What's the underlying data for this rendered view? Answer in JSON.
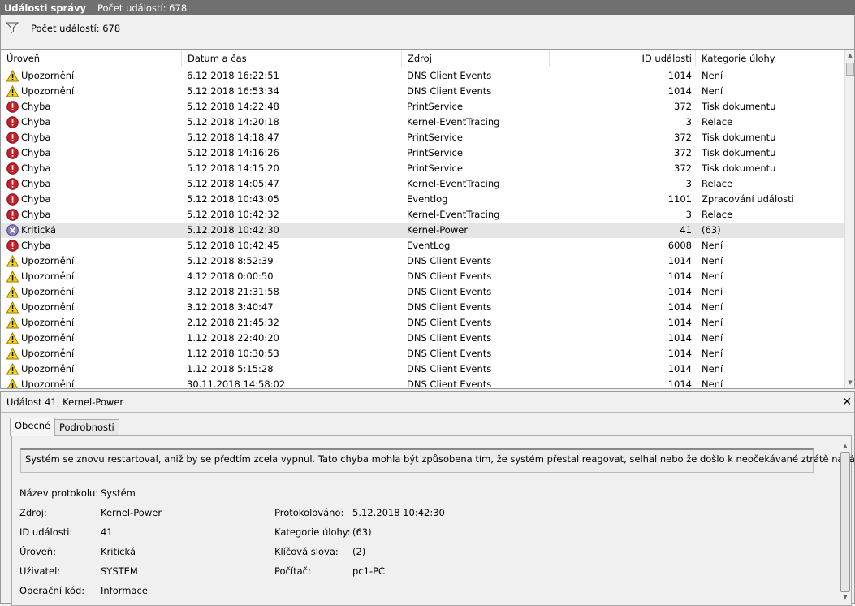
{
  "title": {
    "app": "Události správy",
    "count": "Počet událostí: 678"
  },
  "filter": {
    "text": "Počet událostí: 678"
  },
  "columns": [
    "Úroveň",
    "Datum a čas",
    "Zdroj",
    "ID události",
    "Kategorie úlohy"
  ],
  "rows": [
    {
      "level": "Upozornění",
      "type": "warn",
      "date": "6.12.2018 16:22:51",
      "source": "DNS Client Events",
      "id": "1014",
      "cat": "Není"
    },
    {
      "level": "Upozornění",
      "type": "warn",
      "date": "5.12.2018 16:53:34",
      "source": "DNS Client Events",
      "id": "1014",
      "cat": "Není"
    },
    {
      "level": "Chyba",
      "type": "err",
      "date": "5.12.2018 14:22:48",
      "source": "PrintService",
      "id": "372",
      "cat": "Tisk dokumentu"
    },
    {
      "level": "Chyba",
      "type": "err",
      "date": "5.12.2018 14:20:18",
      "source": "Kernel-EventTracing",
      "id": "3",
      "cat": "Relace"
    },
    {
      "level": "Chyba",
      "type": "err",
      "date": "5.12.2018 14:18:47",
      "source": "PrintService",
      "id": "372",
      "cat": "Tisk dokumentu"
    },
    {
      "level": "Chyba",
      "type": "err",
      "date": "5.12.2018 14:16:26",
      "source": "PrintService",
      "id": "372",
      "cat": "Tisk dokumentu"
    },
    {
      "level": "Chyba",
      "type": "err",
      "date": "5.12.2018 14:15:20",
      "source": "PrintService",
      "id": "372",
      "cat": "Tisk dokumentu"
    },
    {
      "level": "Chyba",
      "type": "err",
      "date": "5.12.2018 14:05:47",
      "source": "Kernel-EventTracing",
      "id": "3",
      "cat": "Relace"
    },
    {
      "level": "Chyba",
      "type": "err",
      "date": "5.12.2018 10:43:05",
      "source": "Eventlog",
      "id": "1101",
      "cat": "Zpracování události"
    },
    {
      "level": "Chyba",
      "type": "err",
      "date": "5.12.2018 10:42:32",
      "source": "Kernel-EventTracing",
      "id": "3",
      "cat": "Relace"
    },
    {
      "level": "Kritická",
      "type": "crit",
      "date": "5.12.2018 10:42:30",
      "source": "Kernel-Power",
      "id": "41",
      "cat": "(63)",
      "selected": true
    },
    {
      "level": "Chyba",
      "type": "err",
      "date": "5.12.2018 10:42:45",
      "source": "EventLog",
      "id": "6008",
      "cat": "Není"
    },
    {
      "level": "Upozornění",
      "type": "warn",
      "date": "5.12.2018 8:52:39",
      "source": "DNS Client Events",
      "id": "1014",
      "cat": "Není"
    },
    {
      "level": "Upozornění",
      "type": "warn",
      "date": "4.12.2018 0:00:50",
      "source": "DNS Client Events",
      "id": "1014",
      "cat": "Není"
    },
    {
      "level": "Upozornění",
      "type": "warn",
      "date": "3.12.2018 21:31:58",
      "source": "DNS Client Events",
      "id": "1014",
      "cat": "Není"
    },
    {
      "level": "Upozornění",
      "type": "warn",
      "date": "3.12.2018 3:40:47",
      "source": "DNS Client Events",
      "id": "1014",
      "cat": "Není"
    },
    {
      "level": "Upozornění",
      "type": "warn",
      "date": "2.12.2018 21:45:32",
      "source": "DNS Client Events",
      "id": "1014",
      "cat": "Není"
    },
    {
      "level": "Upozornění",
      "type": "warn",
      "date": "1.12.2018 22:40:20",
      "source": "DNS Client Events",
      "id": "1014",
      "cat": "Není"
    },
    {
      "level": "Upozornění",
      "type": "warn",
      "date": "1.12.2018 10:30:53",
      "source": "DNS Client Events",
      "id": "1014",
      "cat": "Není"
    },
    {
      "level": "Upozornění",
      "type": "warn",
      "date": "1.12.2018 5:15:28",
      "source": "DNS Client Events",
      "id": "1014",
      "cat": "Není"
    },
    {
      "level": "Upozornění",
      "type": "warn",
      "date": "30.11.2018 14:58:02",
      "source": "DNS Client Events",
      "id": "1014",
      "cat": "Není"
    }
  ],
  "detail": {
    "header": "Událost 41, Kernel-Power",
    "tabs": [
      "Obecné",
      "Podrobnosti"
    ],
    "description": "Systém se znovu restartoval, aniž by se předtím zcela vypnul. Tato chyba mohla být způsobena tím, že systém přestal reagovat, selhal nebo že došlo k neočekávané ztrátě napájení.",
    "left": [
      {
        "label": "Název protokolu:",
        "value": "Systém"
      },
      {
        "label": "Zdroj:",
        "value": "Kernel-Power"
      },
      {
        "label": "ID události:",
        "value": "41"
      },
      {
        "label": "Úroveň:",
        "value": "Kritická"
      },
      {
        "label": "Uživatel:",
        "value": "SYSTEM"
      },
      {
        "label": "Operační kód:",
        "value": "Informace"
      }
    ],
    "right": [
      {
        "label": "Protokolováno:",
        "value": "5.12.2018 10:42:30"
      },
      {
        "label": "Kategorie úlohy:",
        "value": "(63)"
      },
      {
        "label": "Klíčová slova:",
        "value": "(2)"
      },
      {
        "label": "Počítač:",
        "value": "pc1-PC"
      }
    ]
  }
}
